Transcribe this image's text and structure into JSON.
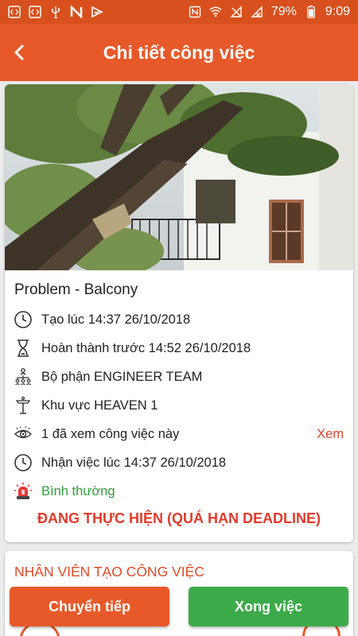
{
  "status_bar": {
    "battery": "79%",
    "time": "9:09"
  },
  "header": {
    "title": "Chi tiết công việc"
  },
  "job": {
    "title": "Problem - Balcony",
    "created": "Tạo lúc 14:37 26/10/2018",
    "deadline": "Hoàn thành trước 14:52 26/10/2018",
    "department": "Bộ phận ENGINEER TEAM",
    "area": "Khu vực HEAVEN 1",
    "views": "1 đã xem công việc này",
    "view_link": "Xem",
    "received": "Nhận việc lúc 14:37 26/10/2018",
    "priority": "Bình thường",
    "status": "ĐANG THỰC HIỆN (QUÁ HẠN DEADLINE)"
  },
  "creator_section": {
    "title": "NHÂN VIÊN TẠO CÔNG VIỆC"
  },
  "actions": {
    "forward": "Chuyển tiếp",
    "done": "Xong việc"
  },
  "colors": {
    "status_bar": "#d8501d",
    "app_bar": "#e8592a",
    "primary": "#e8592a",
    "success": "#3daa4a",
    "danger": "#e23a2a",
    "priority_normal": "#2e9e3a"
  }
}
